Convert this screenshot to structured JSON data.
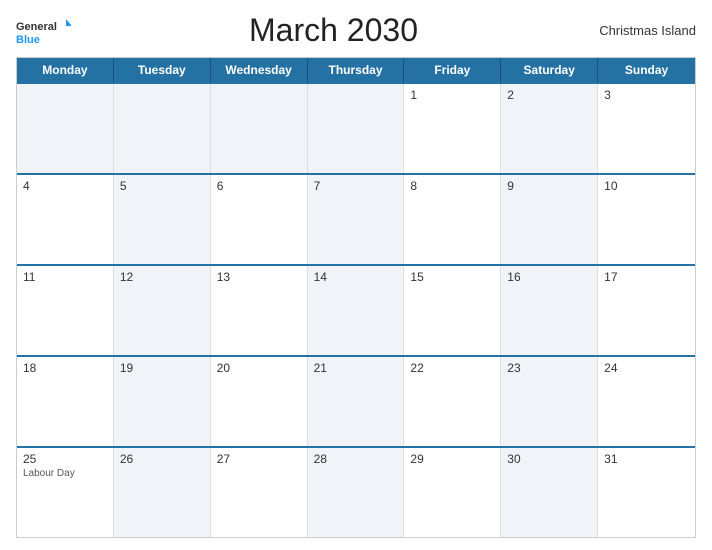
{
  "header": {
    "logo_line1": "General",
    "logo_line2": "Blue",
    "title": "March 2030",
    "location": "Christmas Island"
  },
  "calendar": {
    "days_of_week": [
      "Monday",
      "Tuesday",
      "Wednesday",
      "Thursday",
      "Friday",
      "Saturday",
      "Sunday"
    ],
    "weeks": [
      [
        {
          "day": "",
          "event": "",
          "shaded": true
        },
        {
          "day": "",
          "event": "",
          "shaded": true
        },
        {
          "day": "",
          "event": "",
          "shaded": true
        },
        {
          "day": "",
          "event": "",
          "shaded": true
        },
        {
          "day": "1",
          "event": "",
          "shaded": false
        },
        {
          "day": "2",
          "event": "",
          "shaded": true
        },
        {
          "day": "3",
          "event": "",
          "shaded": false
        }
      ],
      [
        {
          "day": "4",
          "event": "",
          "shaded": false
        },
        {
          "day": "5",
          "event": "",
          "shaded": true
        },
        {
          "day": "6",
          "event": "",
          "shaded": false
        },
        {
          "day": "7",
          "event": "",
          "shaded": true
        },
        {
          "day": "8",
          "event": "",
          "shaded": false
        },
        {
          "day": "9",
          "event": "",
          "shaded": true
        },
        {
          "day": "10",
          "event": "",
          "shaded": false
        }
      ],
      [
        {
          "day": "11",
          "event": "",
          "shaded": false
        },
        {
          "day": "12",
          "event": "",
          "shaded": true
        },
        {
          "day": "13",
          "event": "",
          "shaded": false
        },
        {
          "day": "14",
          "event": "",
          "shaded": true
        },
        {
          "day": "15",
          "event": "",
          "shaded": false
        },
        {
          "day": "16",
          "event": "",
          "shaded": true
        },
        {
          "day": "17",
          "event": "",
          "shaded": false
        }
      ],
      [
        {
          "day": "18",
          "event": "",
          "shaded": false
        },
        {
          "day": "19",
          "event": "",
          "shaded": true
        },
        {
          "day": "20",
          "event": "",
          "shaded": false
        },
        {
          "day": "21",
          "event": "",
          "shaded": true
        },
        {
          "day": "22",
          "event": "",
          "shaded": false
        },
        {
          "day": "23",
          "event": "",
          "shaded": true
        },
        {
          "day": "24",
          "event": "",
          "shaded": false
        }
      ],
      [
        {
          "day": "25",
          "event": "Labour Day",
          "shaded": false
        },
        {
          "day": "26",
          "event": "",
          "shaded": true
        },
        {
          "day": "27",
          "event": "",
          "shaded": false
        },
        {
          "day": "28",
          "event": "",
          "shaded": true
        },
        {
          "day": "29",
          "event": "",
          "shaded": false
        },
        {
          "day": "30",
          "event": "",
          "shaded": true
        },
        {
          "day": "31",
          "event": "",
          "shaded": false
        }
      ]
    ]
  },
  "colors": {
    "header_bg": "#2471a3",
    "accent": "#2196F3"
  }
}
